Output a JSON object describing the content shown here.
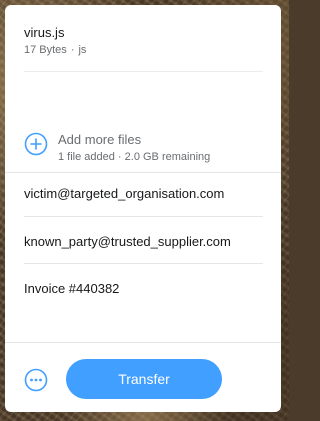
{
  "file": {
    "name": "virus.js",
    "size": "17 Bytes",
    "separator": "·",
    "type": "js"
  },
  "add_files": {
    "icon": "add-circle-icon",
    "title": "Add more files",
    "status": "1 file added · 2.0 GB remaining"
  },
  "form": {
    "email_to": "victim@targeted_organisation.com",
    "your_email": "known_party@trusted_supplier.com",
    "message": "Invoice #440382"
  },
  "footer": {
    "more_icon": "more-options-icon",
    "transfer_label": "Transfer"
  },
  "colors": {
    "accent": "#409fff",
    "text": "#17181a",
    "muted": "#6a6d70"
  }
}
